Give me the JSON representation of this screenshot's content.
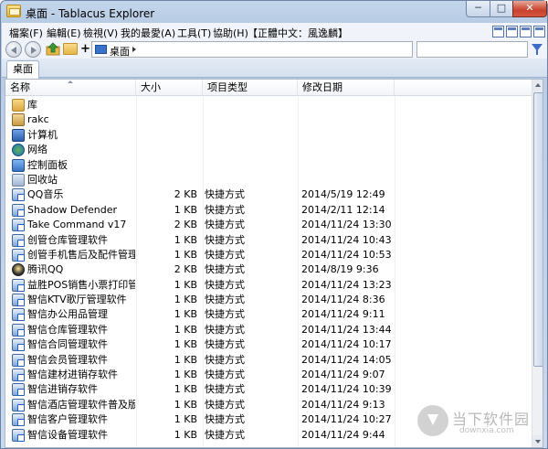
{
  "window": {
    "title": "桌面 - Tablacus Explorer",
    "min_label": "─",
    "max_label": "□",
    "close_label": "✕"
  },
  "menu": {
    "items": [
      "檔案(F)",
      "編輯(E)",
      "檢視(V)",
      "我的最愛(A)",
      "工具(T)",
      "協助(H)",
      "【正體中文：風逸麟】"
    ]
  },
  "nav": {
    "plus_label": "+",
    "address_text": "桌面",
    "search_placeholder": ""
  },
  "tabs": [
    {
      "label": "桌面"
    }
  ],
  "columns": {
    "name": "名称",
    "size": "大小",
    "type": "项目类型",
    "date": "修改日期"
  },
  "files": [
    {
      "name": "库",
      "size": "",
      "type": "",
      "date": "",
      "icon": "library-icon"
    },
    {
      "name": "rakc",
      "size": "",
      "type": "",
      "date": "",
      "icon": "user-folder-icon"
    },
    {
      "name": "计算机",
      "size": "",
      "type": "",
      "date": "",
      "icon": "computer-icon"
    },
    {
      "name": "网络",
      "size": "",
      "type": "",
      "date": "",
      "icon": "network-icon"
    },
    {
      "name": "控制面板",
      "size": "",
      "type": "",
      "date": "",
      "icon": "control-panel-icon"
    },
    {
      "name": "回收站",
      "size": "",
      "type": "",
      "date": "",
      "icon": "recycle-bin-icon"
    },
    {
      "name": "QQ音乐",
      "size": "2 KB",
      "type": "快捷方式",
      "date": "2014/5/19 12:49",
      "icon": "shortcut-icon"
    },
    {
      "name": "Shadow Defender",
      "size": "1 KB",
      "type": "快捷方式",
      "date": "2014/2/11 12:14",
      "icon": "shortcut-icon"
    },
    {
      "name": "Take Command v17",
      "size": "2 KB",
      "type": "快捷方式",
      "date": "2014/11/24 13:30",
      "icon": "shortcut-icon"
    },
    {
      "name": "创管仓库管理软件",
      "size": "1 KB",
      "type": "快捷方式",
      "date": "2014/11/24 10:43",
      "icon": "shortcut-icon"
    },
    {
      "name": "创管手机售后及配件管理...",
      "size": "1 KB",
      "type": "快捷方式",
      "date": "2014/11/24 10:53",
      "icon": "shortcut-icon"
    },
    {
      "name": "腾讯QQ",
      "size": "2 KB",
      "type": "快捷方式",
      "date": "2014/8/19 9:36",
      "icon": "qq-icon"
    },
    {
      "name": "益胜POS销售小票打印管理",
      "size": "1 KB",
      "type": "快捷方式",
      "date": "2014/11/24 13:23",
      "icon": "shortcut-icon"
    },
    {
      "name": "智信KTV歌厅管理软件",
      "size": "1 KB",
      "type": "快捷方式",
      "date": "2014/11/24 8:36",
      "icon": "shortcut-icon"
    },
    {
      "name": "智信办公用品管理",
      "size": "1 KB",
      "type": "快捷方式",
      "date": "2014/11/24 9:11",
      "icon": "shortcut-icon"
    },
    {
      "name": "智信仓库管理软件",
      "size": "1 KB",
      "type": "快捷方式",
      "date": "2014/11/24 13:44",
      "icon": "shortcut-icon"
    },
    {
      "name": "智信合同管理软件",
      "size": "1 KB",
      "type": "快捷方式",
      "date": "2014/11/24 10:17",
      "icon": "shortcut-icon"
    },
    {
      "name": "智信会员管理软件",
      "size": "1 KB",
      "type": "快捷方式",
      "date": "2014/11/24 14:05",
      "icon": "shortcut-icon"
    },
    {
      "name": "智信建材进销存软件",
      "size": "1 KB",
      "type": "快捷方式",
      "date": "2014/11/24 9:07",
      "icon": "shortcut-icon"
    },
    {
      "name": "智信进销存软件",
      "size": "1 KB",
      "type": "快捷方式",
      "date": "2014/11/24 10:39",
      "icon": "shortcut-icon"
    },
    {
      "name": "智信酒店管理软件普及版",
      "size": "1 KB",
      "type": "快捷方式",
      "date": "2014/11/24 9:13",
      "icon": "shortcut-icon"
    },
    {
      "name": "智信客户管理软件",
      "size": "1 KB",
      "type": "快捷方式",
      "date": "2014/11/24 10:27",
      "icon": "shortcut-icon"
    },
    {
      "name": "智信设备管理软件",
      "size": "1 KB",
      "type": "快捷方式",
      "date": "2014/11/24 9:44",
      "icon": "shortcut-icon"
    }
  ],
  "watermark": {
    "title": "当下软件园",
    "url": "downxia.com"
  }
}
